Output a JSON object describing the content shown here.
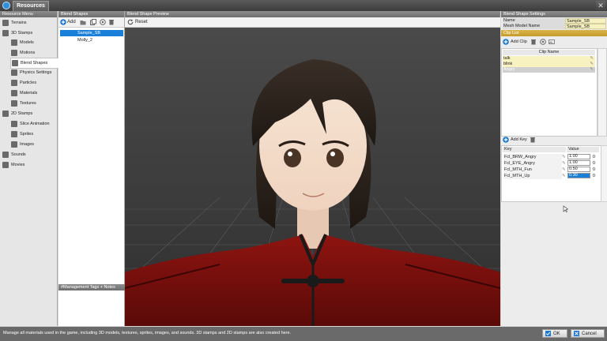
{
  "window": {
    "title": "Resources",
    "close_glyph": "✕"
  },
  "resource_menu": {
    "header": "Resource Menu",
    "items": [
      {
        "label": "Terrains",
        "icon": "terrain-icon"
      },
      {
        "label": "3D Stamps",
        "icon": "cube-icon"
      },
      {
        "label": "Models",
        "icon": "model-icon"
      },
      {
        "label": "Motions",
        "icon": "motion-icon"
      },
      {
        "label": "Blend Shapes",
        "icon": "face-icon"
      },
      {
        "label": "Physics Settings",
        "icon": "physics-icon"
      },
      {
        "label": "Particles",
        "icon": "particles-icon"
      },
      {
        "label": "Materials",
        "icon": "materials-icon"
      },
      {
        "label": "Textures",
        "icon": "textures-icon"
      },
      {
        "label": "2D Stamps",
        "icon": "stamp2d-icon"
      },
      {
        "label": "Slice Animation",
        "icon": "slice-icon"
      },
      {
        "label": "Sprites",
        "icon": "sprite-icon"
      },
      {
        "label": "Images",
        "icon": "image-icon"
      },
      {
        "label": "Sounds",
        "icon": "sound-icon"
      },
      {
        "label": "Movies",
        "icon": "movie-icon"
      }
    ]
  },
  "blend_shapes": {
    "header": "Blend Shapes",
    "add_label": "Add",
    "items": [
      "Sample_SB",
      "Molly_2"
    ],
    "selected": 0,
    "footer": "#Management Tags + Notes"
  },
  "preview": {
    "header": "Blend Shape Preview",
    "reset_label": "Reset"
  },
  "settings": {
    "header": "Blend Shape Settings",
    "properties": [
      {
        "key": "Name",
        "value": "Sample_SB"
      },
      {
        "key": "Mesh Model Name",
        "value": "Sample_SB"
      }
    ],
    "clip_list_header": "Clip List",
    "add_clip_label": "Add Clip",
    "clip_name_header": "Clip Name",
    "clips": [
      "talk",
      "blink",
      "Angry"
    ],
    "add_key_label": "Add Key",
    "key_col": "Key",
    "value_col": "Value",
    "keys": [
      {
        "key": "Fcl_BRW_Angry",
        "value": "1.00"
      },
      {
        "key": "Fcl_EYE_Angry",
        "value": "1.00"
      },
      {
        "key": "Fcl_MTH_Fun",
        "value": "0.50"
      },
      {
        "key": "Fcl_MTH_Up",
        "value": "0.30"
      }
    ]
  },
  "status": {
    "message": "Manage all materials used in the game, including 3D models, textures, sprites, images, and sounds. 3D stamps and 2D stamps are also created here.",
    "ok_label": "OK",
    "cancel_label": "Cancel"
  }
}
